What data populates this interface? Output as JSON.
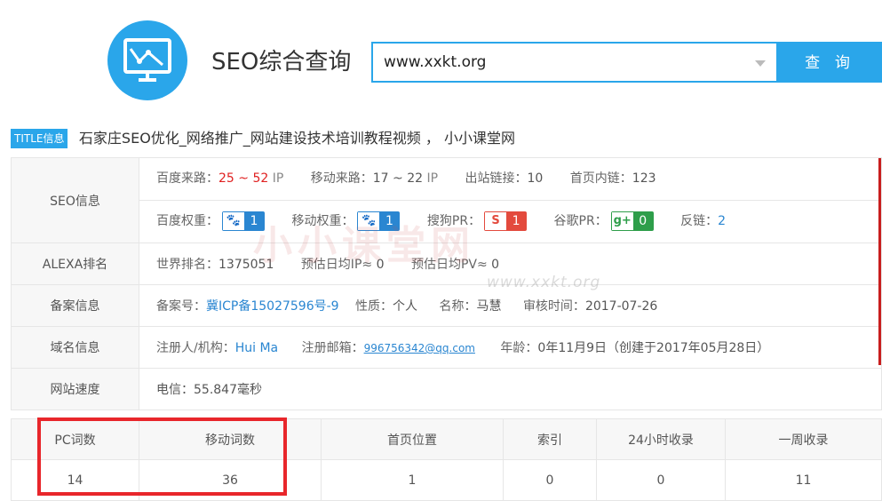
{
  "header": {
    "title": "SEO综合查询",
    "search_value": "www.xxkt.org",
    "search_button": "查 询"
  },
  "title_info": {
    "badge": "TITLE信息",
    "text": "石家庄SEO优化_网络推广_网站建设技术培训教程视频 ， 小小课堂网"
  },
  "seo": {
    "label": "SEO信息",
    "baidu_traffic_label": "百度来路：",
    "baidu_traffic_value": "25 ~ 52",
    "baidu_traffic_unit": "IP",
    "mobile_traffic_label": "移动来路：",
    "mobile_traffic_value": "17 ~ 22",
    "mobile_traffic_unit": "IP",
    "outlinks_label": "出站链接：",
    "outlinks_value": "10",
    "innerlinks_label": "首页内链：",
    "innerlinks_value": "123",
    "baidu_weight_label": "百度权重：",
    "baidu_weight_value": "1",
    "mobile_weight_label": "移动权重：",
    "mobile_weight_value": "1",
    "sogou_pr_label": "搜狗PR：",
    "sogou_pr_value": "1",
    "google_pr_label": "谷歌PR：",
    "google_pr_value": "0",
    "backlinks_label": "反链：",
    "backlinks_value": "2"
  },
  "alexa": {
    "label": "ALEXA排名",
    "world_rank_label": "世界排名：",
    "world_rank_value": "1375051",
    "daily_ip_label": "预估日均IP≈",
    "daily_ip_value": "0",
    "daily_pv_label": "预估日均PV≈",
    "daily_pv_value": "0"
  },
  "icp": {
    "label": "备案信息",
    "number_label": "备案号：",
    "number_value": "冀ICP备15027596号-9",
    "nature_label": "性质：",
    "nature_value": "个人",
    "name_label": "名称：",
    "name_value": "马慧",
    "audit_label": "审核时间：",
    "audit_value": "2017-07-26"
  },
  "domain": {
    "label": "域名信息",
    "registrant_label": "注册人/机构：",
    "registrant_value": "Hui Ma",
    "email_label": "注册邮箱：",
    "email_value": "996756342@qq.com",
    "age_label": "年龄：",
    "age_value": "0年11月9日（创建于2017年05月28日）"
  },
  "speed": {
    "label": "网站速度",
    "value": "电信：55.847毫秒"
  },
  "watermark": {
    "text": "小小课堂网",
    "url": "www.xxkt.org"
  },
  "words_table": {
    "headers": [
      "PC词数",
      "移动词数",
      "首页位置",
      "索引",
      "24小时收录",
      "一周收录"
    ],
    "values": [
      "14",
      "36",
      "1",
      "0",
      "0",
      "11"
    ]
  },
  "colors": {
    "accent": "#2aa6ea",
    "highlight": "#e8262b",
    "baidu": "#2a86d1",
    "sogou": "#e34a3d",
    "google": "#2e9e4a"
  }
}
